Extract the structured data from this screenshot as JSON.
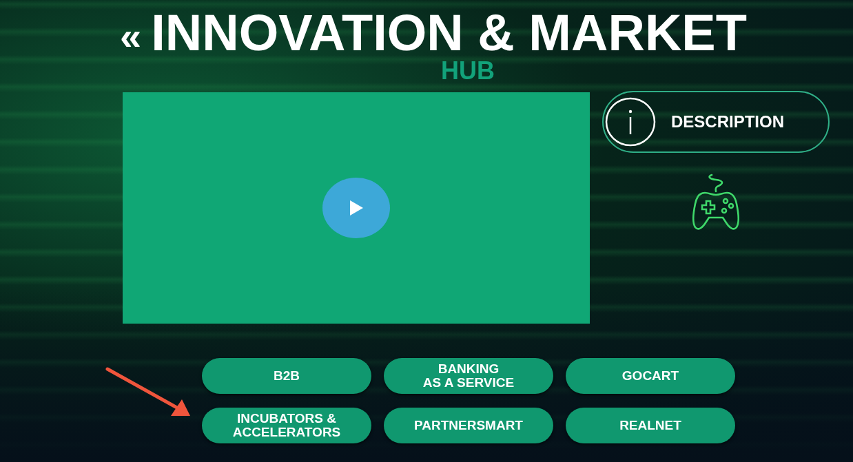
{
  "header": {
    "back": "«",
    "title": "INNOVATION & MARKET",
    "subtitle": "HUB"
  },
  "description_button": {
    "label": "DESCRIPTION"
  },
  "topics": [
    {
      "label": "B2B"
    },
    {
      "label": "BANKING\nAS A SERVICE"
    },
    {
      "label": "GOCART"
    },
    {
      "label": "INCUBATORS &\nACCELERATORS"
    },
    {
      "label": "PARTNERSMART"
    },
    {
      "label": "REALNET"
    }
  ]
}
